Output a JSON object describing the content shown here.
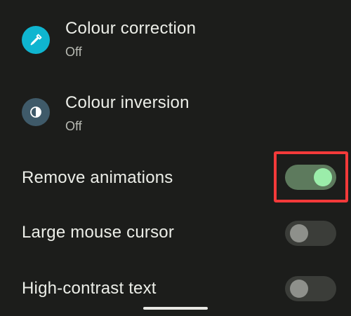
{
  "settings": {
    "colour_correction": {
      "title": "Colour correction",
      "status": "Off"
    },
    "colour_inversion": {
      "title": "Colour inversion",
      "status": "Off"
    },
    "remove_animations": {
      "title": "Remove animations",
      "enabled": true
    },
    "large_mouse_cursor": {
      "title": "Large mouse cursor",
      "enabled": false
    },
    "high_contrast_text": {
      "title": "High-contrast text",
      "enabled": false
    }
  },
  "icons": {
    "colour_correction": "eyedropper-icon",
    "colour_inversion": "contrast-icon"
  },
  "colors": {
    "background": "#1c1d1b",
    "toggle_on_track": "#5d7a5d",
    "toggle_on_thumb": "#9bedaa",
    "toggle_off_track": "#3b3d39",
    "highlight": "#f33a3a"
  }
}
